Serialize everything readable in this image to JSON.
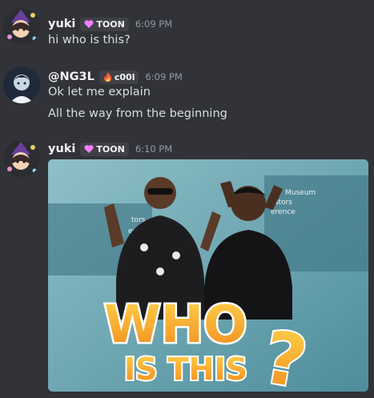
{
  "messages": [
    {
      "username": "yuki",
      "tag": "TOON",
      "time": "6:09 PM",
      "lines": [
        "hi who is this?"
      ]
    },
    {
      "username": "@NG3L",
      "tag": "c00l",
      "time": "6:09 PM",
      "lines": [
        "Ok let me explain",
        "All the way from the beginning"
      ]
    },
    {
      "username": "yuki",
      "tag": "TOON",
      "time": "6:10 PM",
      "lines": []
    }
  ],
  "embed_image": {
    "text_line1": "WHO",
    "text_line2": "IS THIS",
    "question_mark": "?",
    "background_text_left": [
      "tors",
      "erence"
    ],
    "background_text_right": [
      "Museum",
      "ators",
      "erence"
    ]
  },
  "colors": {
    "accent_pink": "#f47fff",
    "embed_orange": "#f5a623"
  }
}
